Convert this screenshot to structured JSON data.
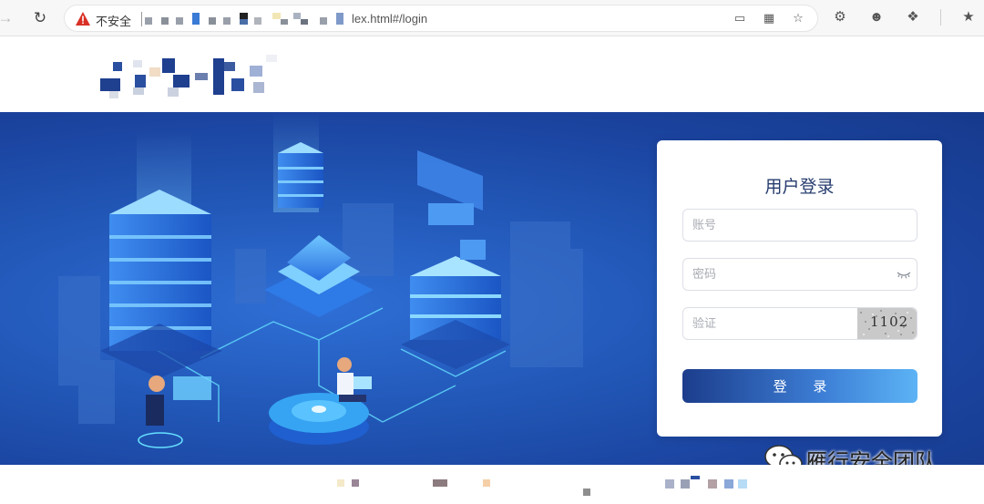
{
  "browser": {
    "back_icon": "back-arrow-icon",
    "reload_icon": "reload-icon",
    "security_warning": "不安全",
    "url_visible": "lex.html#/login",
    "address_icons": [
      "screen-cast-icon",
      "app-grid-icon",
      "favorite-add-icon"
    ],
    "toolbar_icons": [
      "extension-icon",
      "profile-icon",
      "puzzle-icon",
      "favorites-icon"
    ]
  },
  "login": {
    "title": "用户登录",
    "username_placeholder": "账号",
    "password_placeholder": "密码",
    "captcha_placeholder": "验证",
    "captcha_text": "1102",
    "submit_label": "登 录"
  },
  "watermark": {
    "text": "雁行安全团队",
    "icon": "wechat-icon"
  },
  "colors": {
    "banner_dark": "#163a8c",
    "banner_light": "#2f6fd6",
    "title_color": "#263c6e",
    "button_start": "#1c3d8c",
    "button_end": "#5cb3f5",
    "warning_red": "#d93025"
  }
}
